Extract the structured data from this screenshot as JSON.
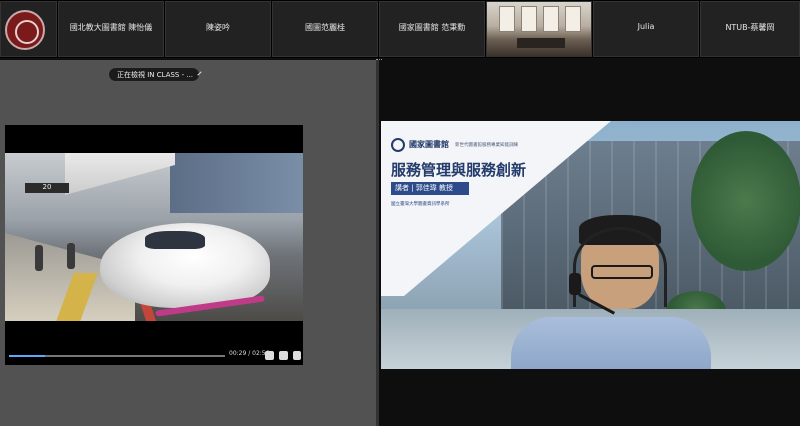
{
  "participants": [
    {
      "name": ""
    },
    {
      "name": "國北教大圖書館 陳怡儀"
    },
    {
      "name": "陳姿吟"
    },
    {
      "name": "國圖范麗桂"
    },
    {
      "name": "國家圖書館 范秉勳"
    },
    {
      "name": ""
    },
    {
      "name": "Julia"
    },
    {
      "name": "NTUB-蔡馨岡"
    }
  ],
  "share": {
    "viewing_label": "正在檢視 IN CLASS - ..."
  },
  "video": {
    "sign_text": "20",
    "current_time": "00:29",
    "duration": "02:56",
    "time_display": "00:29 / 02:56",
    "progress": 0.165
  },
  "slide": {
    "org": "國家圖書館",
    "subtitle": "新世代圖書館服務專業知能訓練",
    "title": "服務管理與服務創新",
    "speaker": "講者 | 郭佳瑋 教授",
    "affiliation": "國立臺灣大學圖書資訊學系所"
  },
  "colors": {
    "accent_progress": "#5aa9ff",
    "slide_blue": "#243c6b",
    "tile_bg": "#222222"
  }
}
